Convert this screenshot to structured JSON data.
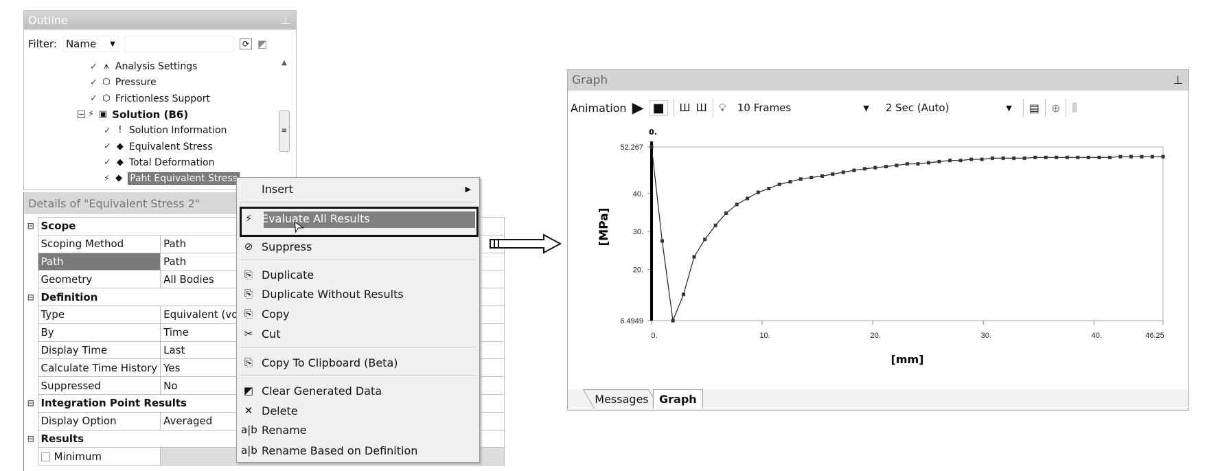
{
  "outline": {
    "title": "Outline",
    "filter_label": "Filter:",
    "filter_value": "Name",
    "filter_text": "",
    "tree": [
      {
        "label": "Analysis Settings",
        "icon": "analysis-settings-icon",
        "level": 2,
        "bold": false
      },
      {
        "label": "Pressure",
        "icon": "pressure-icon",
        "level": 2,
        "bold": false
      },
      {
        "label": "Frictionless Support",
        "icon": "support-icon",
        "level": 2,
        "bold": false
      },
      {
        "label": "Solution (B6)",
        "icon": "solution-icon",
        "level": 1,
        "bold": true
      },
      {
        "label": "Solution Information",
        "icon": "info-icon",
        "level": 3,
        "bold": false
      },
      {
        "label": "Equivalent Stress",
        "icon": "result-icon",
        "level": 3,
        "bold": false
      },
      {
        "label": "Total Deformation",
        "icon": "result-icon",
        "level": 3,
        "bold": false
      },
      {
        "label": "Paht Equivalent Stress",
        "icon": "result-icon",
        "level": 3,
        "bold": false,
        "selected": true
      }
    ]
  },
  "details": {
    "title": "Details of \"Equivalent Stress 2\"",
    "rows": [
      {
        "cat": "Scope"
      },
      {
        "k": "Scoping Method",
        "v": "Path"
      },
      {
        "k": "Path",
        "v": "Path",
        "hl": true
      },
      {
        "k": "Geometry",
        "v": "All Bodies"
      },
      {
        "cat": "Definition"
      },
      {
        "k": "Type",
        "v": "Equivalent (von-Mises) Stress"
      },
      {
        "k": "By",
        "v": "Time"
      },
      {
        "k": "Display Time",
        "v": "Last"
      },
      {
        "k": "Calculate Time History",
        "v": "Yes"
      },
      {
        "k": "Suppressed",
        "v": "No"
      },
      {
        "cat": "Integration Point Results"
      },
      {
        "k": "Display Option",
        "v": "Averaged"
      },
      {
        "cat": "Results"
      },
      {
        "k": "Minimum",
        "v": "",
        "check": true
      }
    ]
  },
  "menu": {
    "items": [
      {
        "label": "Insert",
        "icon": "",
        "submenu": true
      },
      {
        "sep": true
      },
      {
        "label": "Evaluate All Results",
        "icon": "evaluate-icon",
        "highlight": true
      },
      {
        "label": "Suppress",
        "icon": "suppress-icon"
      },
      {
        "sep": true
      },
      {
        "label": "Duplicate",
        "icon": "duplicate-icon"
      },
      {
        "label": "Duplicate Without Results",
        "icon": "duplicate-icon"
      },
      {
        "label": "Copy",
        "icon": "copy-icon"
      },
      {
        "label": "Cut",
        "icon": "cut-icon"
      },
      {
        "sep": true
      },
      {
        "label": "Copy To Clipboard (Beta)",
        "icon": "clipboard-icon"
      },
      {
        "sep": true
      },
      {
        "label": "Clear Generated Data",
        "icon": "eraser-icon"
      },
      {
        "label": "Delete",
        "icon": "delete-icon"
      },
      {
        "label": "Rename",
        "icon": "rename-icon"
      },
      {
        "label": "Rename Based on Definition",
        "icon": "rename-icon"
      }
    ]
  },
  "graph": {
    "title": "Graph",
    "animation_label": "Animation",
    "frames": "10 Frames",
    "duration": "2 Sec (Auto)",
    "tabs": [
      "Messages",
      "Graph"
    ],
    "active_tab": "Graph"
  },
  "chart_data": {
    "type": "line",
    "xlabel": "[mm]",
    "ylabel": "[MPa]",
    "cursor_label": "0.",
    "xlim": [
      0,
      46.25
    ],
    "ylim": [
      6.4949,
      52.267
    ],
    "xticks": [
      "0.",
      "10.",
      "20.",
      "30.",
      "40.",
      "46.25"
    ],
    "xtick_values": [
      0,
      10,
      20,
      30,
      40,
      46.25
    ],
    "yticks": [
      "6.4949",
      "20.",
      "30.",
      "40.",
      "52.267"
    ],
    "ytick_values": [
      6.4949,
      20,
      30,
      40,
      52.267
    ],
    "grid": false,
    "x": [
      0,
      0.96,
      1.93,
      2.89,
      3.85,
      4.82,
      5.78,
      6.74,
      7.71,
      8.67,
      9.64,
      10.6,
      11.56,
      12.53,
      13.49,
      14.45,
      15.42,
      16.38,
      17.34,
      18.31,
      19.27,
      20.23,
      21.2,
      22.16,
      23.12,
      24.09,
      25.05,
      26.01,
      26.98,
      27.94,
      28.91,
      29.87,
      30.83,
      31.8,
      32.76,
      33.72,
      34.69,
      35.65,
      36.61,
      37.58,
      38.54,
      39.5,
      40.47,
      41.43,
      42.39,
      43.36,
      44.32,
      45.28,
      46.25
    ],
    "y": [
      52.267,
      27.5,
      6.4949,
      13.4,
      23.3,
      27.9,
      31.6,
      34.8,
      37.1,
      38.7,
      40.3,
      41.3,
      42.4,
      43.1,
      43.8,
      44.2,
      44.6,
      45.1,
      45.6,
      46.1,
      46.5,
      46.8,
      47.1,
      47.4,
      47.8,
      47.8,
      48.1,
      48.4,
      48.7,
      48.7,
      49.0,
      49.0,
      49.3,
      49.3,
      49.3,
      49.3,
      49.5,
      49.5,
      49.5,
      49.5,
      49.5,
      49.5,
      49.5,
      49.5,
      49.7,
      49.7,
      49.7,
      49.7,
      49.7
    ]
  }
}
